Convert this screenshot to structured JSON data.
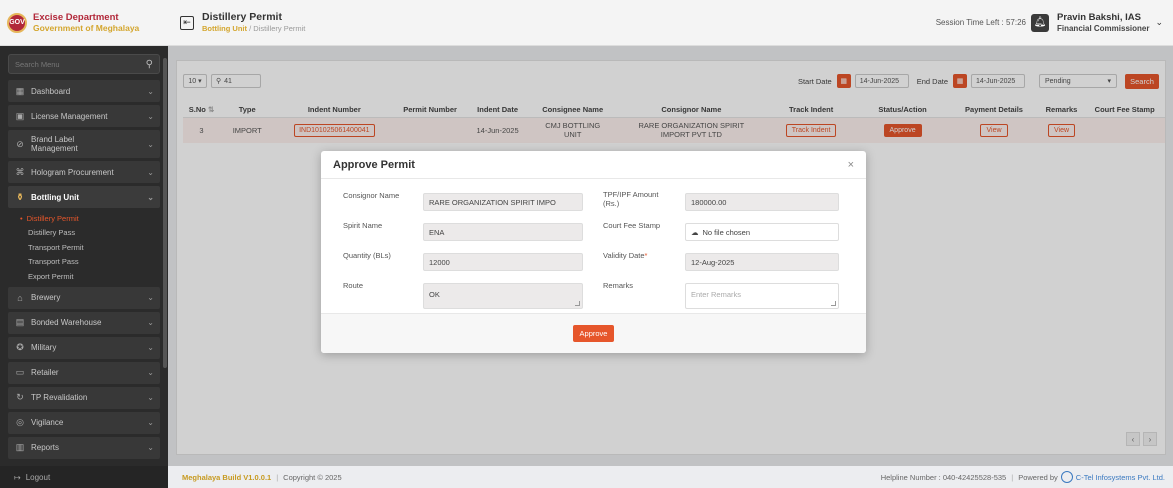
{
  "brand": {
    "line1": "Excise Department",
    "line2": "Government of Meghalaya",
    "logo_text": "GOV"
  },
  "sidebar": {
    "search_placeholder": "Search Menu",
    "items": [
      {
        "label": "Dashboard",
        "icon": "dashboard-icon",
        "glyph": "▦"
      },
      {
        "label": "License Management",
        "icon": "license-icon",
        "glyph": "▣"
      },
      {
        "label": "Brand Label Management",
        "icon": "tag-icon",
        "glyph": "⊘"
      },
      {
        "label": "Hologram Procurement",
        "icon": "hologram-icon",
        "glyph": "⌘"
      },
      {
        "label": "Bottling Unit",
        "icon": "bottle-icon",
        "glyph": "⚱"
      }
    ],
    "submenu": [
      "Distillery Permit",
      "Distillery Pass",
      "Transport Permit",
      "Transport Pass",
      "Export Permit"
    ],
    "items_after": [
      {
        "label": "Brewery",
        "icon": "brewery-icon",
        "glyph": "⌂"
      },
      {
        "label": "Bonded Warehouse",
        "icon": "warehouse-icon",
        "glyph": "▤"
      },
      {
        "label": "Military",
        "icon": "military-icon",
        "glyph": "✪"
      },
      {
        "label": "Retailer",
        "icon": "retailer-icon",
        "glyph": "▭"
      },
      {
        "label": "TP Revalidation",
        "icon": "refresh-icon",
        "glyph": "↻"
      },
      {
        "label": "Vigilance",
        "icon": "vigilance-icon",
        "glyph": "◎"
      },
      {
        "label": "Reports",
        "icon": "reports-icon",
        "glyph": "▥"
      }
    ],
    "logout": "Logout"
  },
  "header": {
    "title": "Distillery Permit",
    "breadcrumb_link": "Bottling Unit",
    "breadcrumb_sep": "/",
    "breadcrumb_current": "Distillery Permit",
    "session_label": "Session Time Left : 57:26",
    "user_name": "Pravin Bakshi, IAS",
    "user_role": "Financial Commissioner"
  },
  "toolbar": {
    "page_size": "10",
    "search_value": "41",
    "start_label": "Start Date",
    "start_value": "14-Jun-2025",
    "end_label": "End Date",
    "end_value": "14-Jun-2025",
    "status_value": "Pending",
    "search_btn": "Search"
  },
  "table": {
    "headers": [
      "S.No",
      "Type",
      "Indent Number",
      "Permit Number",
      "Indent Date",
      "Consignee Name",
      "Consignor Name",
      "Track Indent",
      "Status/Action",
      "Payment Details",
      "Remarks",
      "Court Fee Stamp"
    ],
    "row": {
      "sno": "3",
      "type": "IMPORT",
      "indent_number": "IND101025061400041",
      "permit_number": "",
      "indent_date": "14-Jun-2025",
      "consignee_l1": "CMJ BOTTLING",
      "consignee_l2": "UNIT",
      "consignor_l1": "RARE ORGANIZATION SPIRIT",
      "consignor_l2": "IMPORT PVT LTD",
      "track": "Track Indent",
      "action": "Approve",
      "payment": "View",
      "remarks": "View",
      "court_fee": ""
    }
  },
  "modal": {
    "title": "Approve Permit",
    "close": "×",
    "consignor_label": "Consignor Name",
    "consignor_value": "RARE ORGANIZATION SPIRIT IMPO",
    "tpf_label_l1": "TPF/IPF Amount",
    "tpf_label_l2": "(Rs.)",
    "tpf_value": "180000.00",
    "spirit_label": "Spirit Name",
    "spirit_value": "ENA",
    "court_label": "Court Fee Stamp",
    "court_value": "No file chosen",
    "qty_label": "Quantity (BLs)",
    "qty_value": "12000",
    "validity_label": "Validity Date",
    "validity_value": "12-Aug-2025",
    "route_label": "Route",
    "route_value": "OK",
    "remarks_label": "Remarks",
    "remarks_placeholder": "Enter Remarks",
    "approve_btn": "Approve"
  },
  "footer": {
    "build": "Meghalaya Build V1.0.0.1",
    "sep": "|",
    "copyright": "Copyright © 2025",
    "helpline": "Helpline Number : 040-42425528-535",
    "powered": "Powered by",
    "company": "C-Tel Infosystems Pvt. Ltd."
  },
  "colors": {
    "accent": "#e6562b",
    "brand_red": "#b2283a",
    "brand_gold": "#d4a62e",
    "sidebar_bg": "#2b2b2b"
  }
}
